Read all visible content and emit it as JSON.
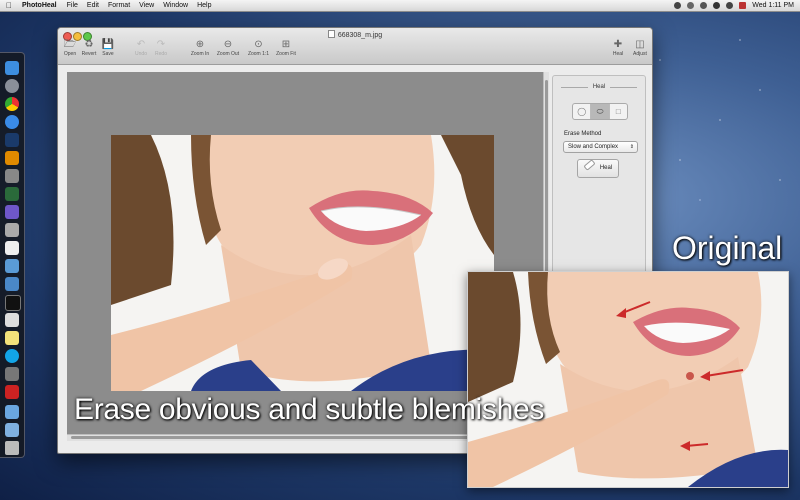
{
  "menubar": {
    "app_name": "PhotoHeal",
    "items": [
      "File",
      "Edit",
      "Format",
      "View",
      "Window",
      "Help"
    ],
    "clock": "Wed 1:11 PM"
  },
  "window": {
    "title": "668308_m.jpg",
    "toolbar": {
      "open": "Open",
      "revert": "Revert",
      "save": "Save",
      "undo": "Undo",
      "redo": "Redo",
      "zoom_in": "Zoom In",
      "zoom_out": "Zoom Out",
      "zoom_1_1": "Zoom 1:1",
      "zoom_fit": "Zoom Fit",
      "heal": "Heal",
      "adjust": "Adjust"
    }
  },
  "heal_panel": {
    "title": "Heal",
    "erase_method_label": "Erase Method",
    "erase_method_value": "Slow and Complex",
    "heal_button": "Heal"
  },
  "captions": {
    "main": "Erase obvious and subtle blemishes",
    "original": "Original"
  },
  "colors": {
    "skin": "#f2cdb4",
    "hair": "#6b4a2e",
    "shirt": "#2a3f8a",
    "lips": "#d9707a",
    "arrow": "#cc2a2a"
  }
}
